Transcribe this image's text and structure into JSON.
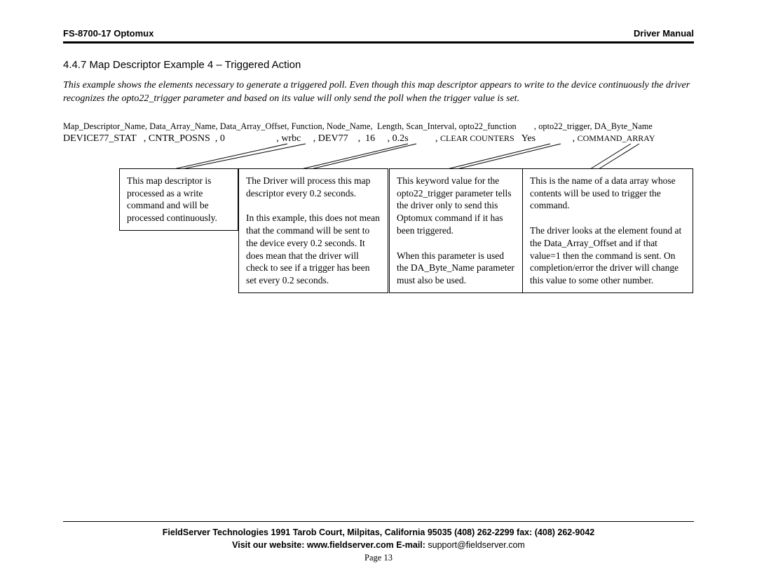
{
  "header": {
    "left": "FS-8700-17 Optomux",
    "right": "Driver Manual"
  },
  "section": {
    "title": "4.4.7   Map Descriptor Example 4 – Triggered Action",
    "intro": "This example shows the elements necessary to generate a triggered poll. Even though this map descriptor appears to write to the device continuously the driver recognizes the opto22_trigger parameter and based on its value will only send the poll when the trigger value is set."
  },
  "csv": {
    "header_line": "Map_Descriptor_Name, Data_Array_Name, Data_Array_Offset, Function, Node_Name,  Length, Scan_Interval, opto22_function        , opto22_trigger, DA_Byte_Name",
    "value_parts": {
      "a": "DEVICE77_STAT   , CNTR_POSNS  , 0                     , wrbc     , DEV77    ,  16     , 0.2s           , ",
      "b": "CLEAR COUNTERS",
      "c": "   Yes               , ",
      "d": "COMMAND_ARRAY"
    }
  },
  "callouts": {
    "box1": "This map descriptor is processed as a write command and will be processed continuously.",
    "box2a": "The Driver will process this map descriptor every 0.2 seconds.",
    "box2b": "In this example, this does not mean that the command will be sent to the device every 0.2 seconds. It does mean that the driver will check to see if a trigger has been set every 0.2 seconds.",
    "box3a": "This  keyword value for the opto22_trigger parameter tells the driver only to send this Optomux command if it has been triggered.",
    "box3b": "When this parameter is used the DA_Byte_Name parameter must also be used.",
    "box4a": "This is the name of a data array whose contents will be used to trigger the command.",
    "box4b": "The driver looks at the element found at the Data_Array_Offset and if that value=1 then the command is sent. On completion/error the driver will change this value to some other number."
  },
  "footer": {
    "line1": "FieldServer Technologies 1991 Tarob Court, Milpitas, California 95035 (408) 262-2299 fax: (408) 262-9042",
    "line2_prefix": "Visit our website: www.fieldserver.com         E-mail:",
    "line2_email": "  support@fieldserver.com",
    "page": "Page 13"
  }
}
